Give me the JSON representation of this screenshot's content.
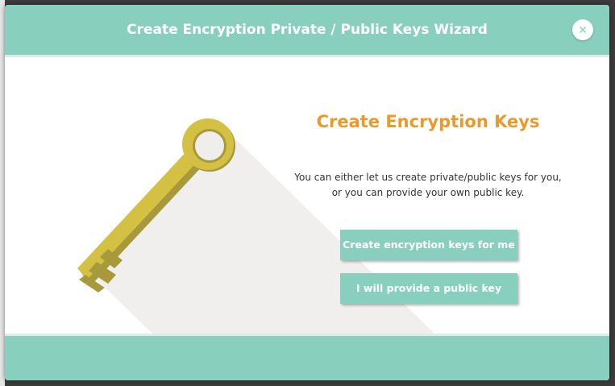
{
  "dialog": {
    "title": "Create Encryption Private / Public Keys Wizard",
    "close_icon": "close-icon"
  },
  "content": {
    "heading": "Create Encryption Keys",
    "description_line1": "You can either let us create private/public keys for you,",
    "description_line2": "or you can provide your own public key."
  },
  "actions": {
    "create_label": "Create encryption keys for me",
    "provide_label": "I will provide a public key"
  },
  "illustration": {
    "icon": "key-icon"
  },
  "colors": {
    "accent": "#88cfbd",
    "heading": "#e89a2c",
    "key": "#d4c043",
    "key_shadow": "#a89a3a"
  }
}
